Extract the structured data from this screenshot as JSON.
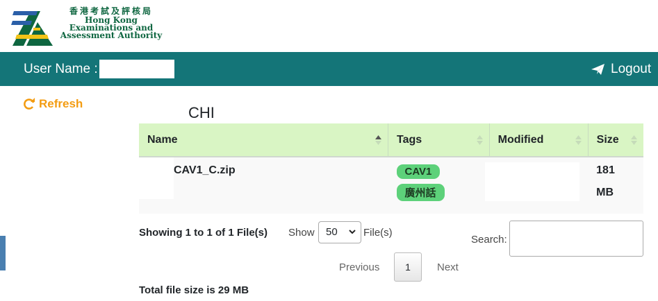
{
  "header": {
    "logo_zh": "香港考試及評核局",
    "logo_en_line1": "Hong Kong",
    "logo_en_line2": "Examinations and",
    "logo_en_line3": "Assessment Authority",
    "brand_green": "#0e6640"
  },
  "navbar": {
    "user_label": "User Name :",
    "user_value": "",
    "logout_label": "Logout",
    "bg_color": "#147578"
  },
  "sidebar": {
    "refresh_label": "Refresh",
    "refresh_icon": "refresh-icon",
    "accent": "#f39c12"
  },
  "main": {
    "folder_title": "CHI",
    "table": {
      "columns": [
        "Name",
        "Tags",
        "Modified",
        "Size"
      ],
      "rows": [
        {
          "name": "CAV1_C.zip",
          "tags": [
            "CAV1",
            "廣州話"
          ],
          "modified": "",
          "size_line1": "181",
          "size_line2": "MB"
        }
      ]
    },
    "showing_text": "Showing 1 to 1 of 1 File(s)",
    "show_label": "Show",
    "page_size": "50",
    "files_label": "File(s)",
    "search_label": "Search:",
    "search_value": "",
    "pager": {
      "previous": "Previous",
      "current_page": "1",
      "next": "Next"
    },
    "total_size_text": "Total file size is 29 MB"
  }
}
